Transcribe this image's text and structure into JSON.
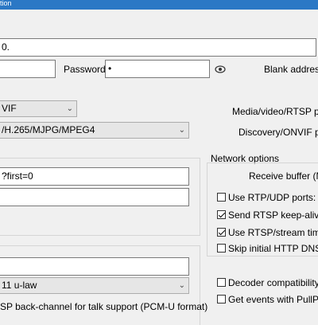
{
  "window": {
    "title_fragment": "tion"
  },
  "url_field": {
    "value": "0."
  },
  "left_input_1": {
    "value": ""
  },
  "password": {
    "label": "Password",
    "value": "•"
  },
  "blank_address": {
    "label": "Blank address"
  },
  "protocol_combo": {
    "value": "VIF"
  },
  "codec_combo": {
    "value": "/H.265/MJPG/MPEG4"
  },
  "media_port_label": "Media/video/RTSP po",
  "discovery_port_label": "Discovery/ONVIF po",
  "stream_field_1": {
    "value": "?first=0"
  },
  "stream_field_2": {
    "value": ""
  },
  "network_options": {
    "title": "Network options",
    "receive_buffer": "Receive buffer (M",
    "use_rtp_udp": {
      "label": "Use RTP/UDP ports:",
      "checked": false
    },
    "send_rtsp_keepalives": {
      "label": "Send RTSP keep-alives",
      "checked": true
    },
    "use_rtsp_stream_timed": {
      "label": "Use RTSP/stream timed",
      "checked": true
    },
    "skip_http_dns": {
      "label": "Skip initial HTTP DNS a",
      "checked": false
    }
  },
  "audio_field": {
    "value": ""
  },
  "audio_codec_combo": {
    "value": "11 u-law"
  },
  "backchannel_text": "SP back-channel for talk support (PCM-U format)",
  "decoder_compat": {
    "label": "Decoder compatibility (",
    "checked": false
  },
  "pullpoint": {
    "label": "Get events with PullPoi",
    "checked": false
  }
}
